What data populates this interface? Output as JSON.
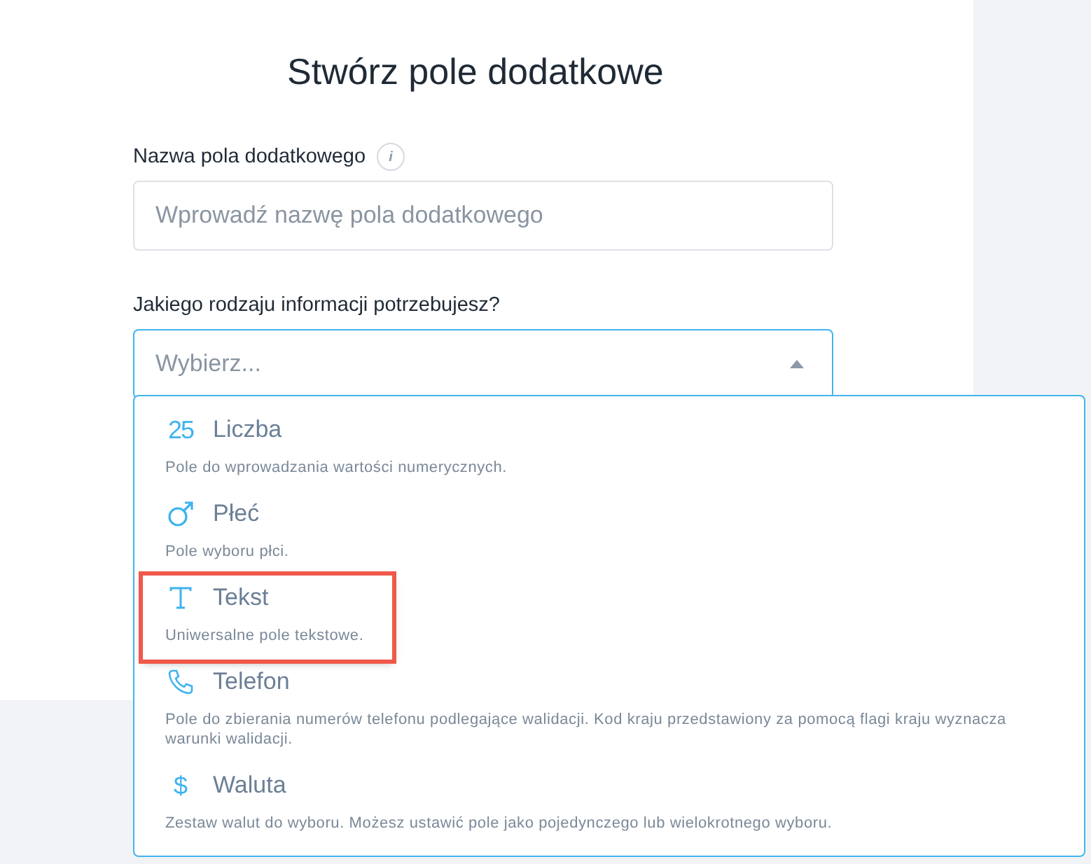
{
  "title": "Stwórz pole dodatkowe",
  "name_field": {
    "label": "Nazwa pola dodatkowego",
    "info": "i",
    "placeholder": "Wprowadź nazwę pola dodatkowego"
  },
  "type_field": {
    "label": "Jakiego rodzaju informacji potrzebujesz?",
    "placeholder": "Wybierz...",
    "expanded": true
  },
  "options": [
    {
      "kind": "number",
      "glyph": "25",
      "label": "Liczba",
      "description": "Pole do wprowadzania wartości numerycznych.",
      "highlighted": false
    },
    {
      "kind": "gender",
      "label": "Płeć",
      "description": "Pole wyboru płci.",
      "highlighted": false
    },
    {
      "kind": "text",
      "label": "Tekst",
      "description": "Uniwersalne pole tekstowe.",
      "highlighted": true
    },
    {
      "kind": "phone",
      "label": "Telefon",
      "description": "Pole do zbierania numerów telefonu podlegające walidacji. Kod kraju przedstawiony za pomocą flagi kraju wyznacza warunki walidacji.",
      "highlighted": false
    },
    {
      "kind": "currency",
      "glyph": "$",
      "label": "Waluta",
      "description": "Zestaw walut do wyboru. Możesz ustawić pole jako pojedynczego lub wielokrotnego wyboru.",
      "highlighted": false
    }
  ]
}
